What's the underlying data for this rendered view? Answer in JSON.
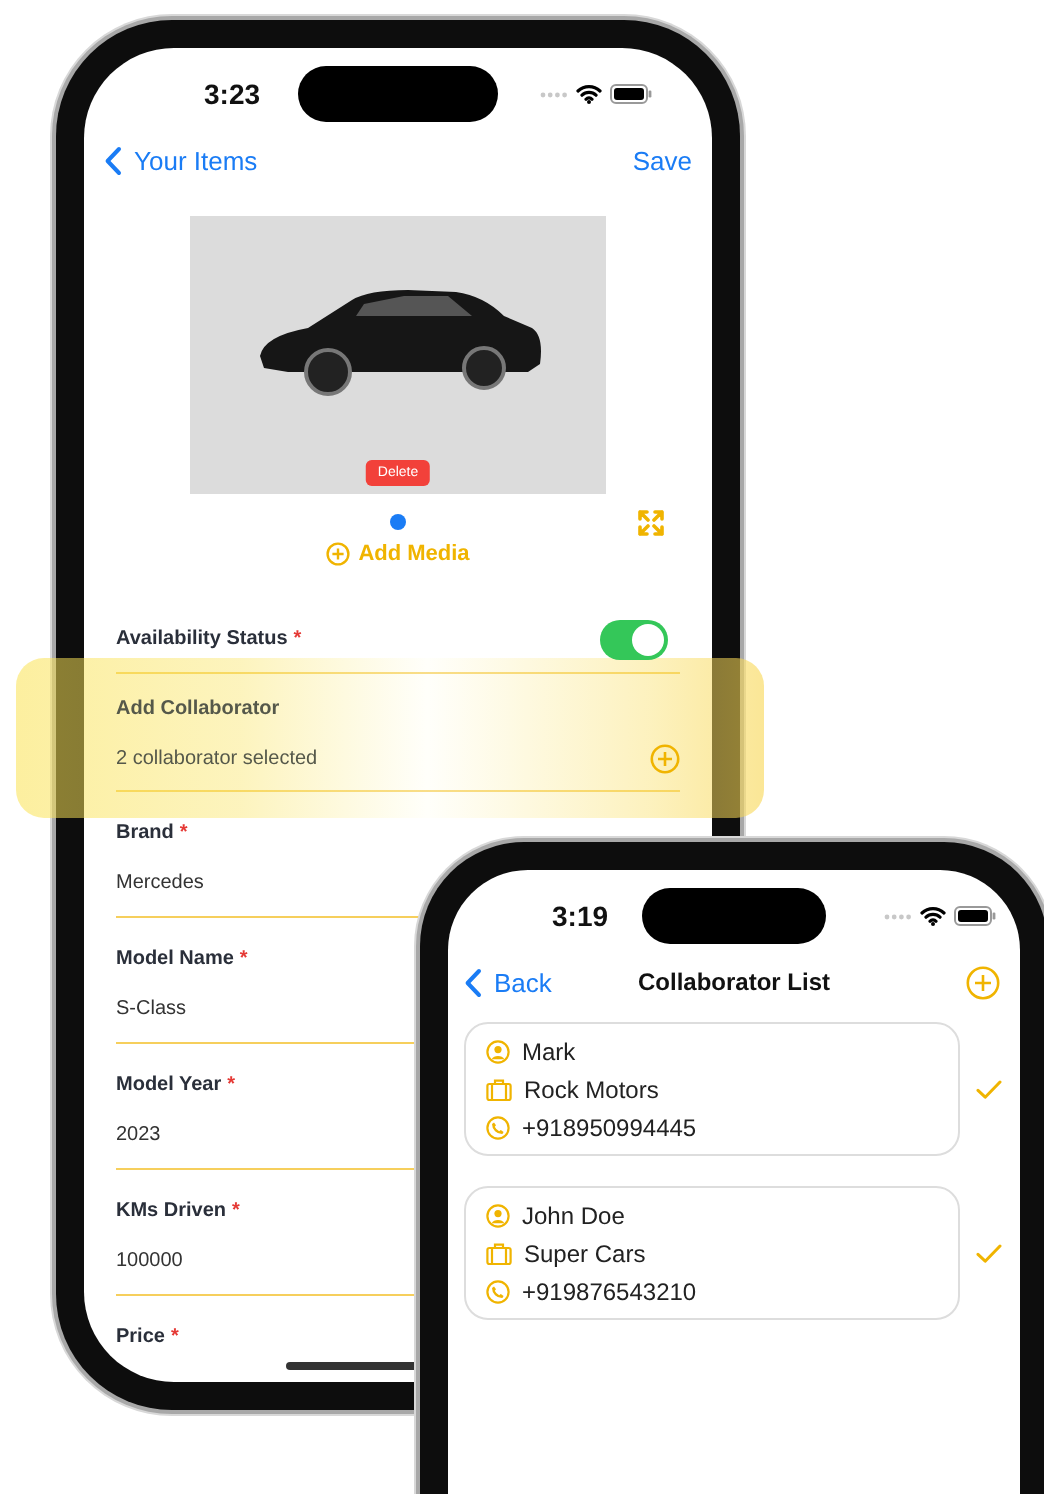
{
  "item_editor": {
    "status_bar": {
      "time": "3:23"
    },
    "nav": {
      "back": "Your Items",
      "action": "Save"
    },
    "media": {
      "delete": "Delete",
      "pages": [
        {
          "selected": true
        }
      ],
      "add": "Add Media"
    },
    "fields": [
      {
        "kind": "toggle",
        "label": "Availability Status",
        "mark": "*",
        "on": true
      },
      {
        "kind": "picker",
        "label": "Add Collaborator",
        "value": "2 collaborator selected",
        "highlighted": true
      },
      {
        "kind": "text",
        "label": "Brand",
        "mark": "*",
        "value": "Mercedes"
      },
      {
        "kind": "text",
        "label": "Model Name",
        "mark": "*",
        "value": "S-Class"
      },
      {
        "kind": "text",
        "label": "Model Year",
        "mark": "*",
        "value": "2023"
      },
      {
        "kind": "text",
        "label": "KMs Driven",
        "mark": "*",
        "value": "100000"
      },
      {
        "kind": "text",
        "label": "Price",
        "mark": "*"
      }
    ]
  },
  "collaborator_list": {
    "status_bar": {
      "time": "3:19"
    },
    "nav": {
      "back": "Back",
      "title": "Collaborator List"
    },
    "collaborators": [
      {
        "name": "Mark",
        "company": "Rock Motors",
        "phone": "+918950994445",
        "checked": true
      },
      {
        "name": "John Doe",
        "company": "Super Cars",
        "phone": "+919876543210",
        "checked": true
      }
    ]
  }
}
